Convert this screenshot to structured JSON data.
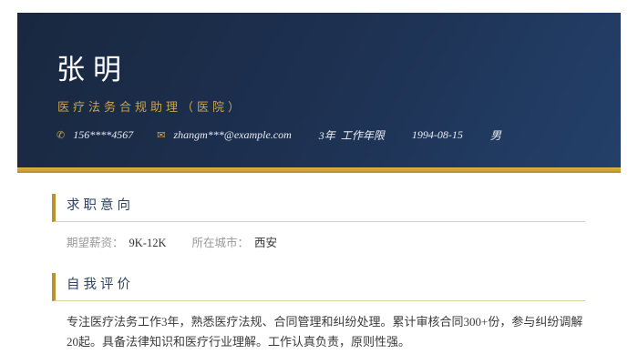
{
  "header": {
    "name": "张明",
    "job_title": "医疗法务合规助理（医院）",
    "contact": {
      "phone_glyph": "✆",
      "phone": "156****4567",
      "email_glyph": "✉",
      "email": "zhangm***@example.com",
      "experience_value": "3年",
      "experience_label": "工作年限",
      "birth_date": "1994-08-15",
      "gender": "男"
    }
  },
  "sections": [
    {
      "title": "求职意向",
      "fields": [
        {
          "label": "期望薪资：",
          "value": "9K-12K"
        },
        {
          "label": "所在城市：",
          "value": "西安"
        }
      ]
    },
    {
      "title": "自我评价",
      "paragraph": "专注医疗法务工作3年，熟悉医疗法规、合同管理和纠纷处理。累计审核合同300+份，参与纠纷调解20起。具备法律知识和医疗行业理解。工作认真负责，原则性强。"
    }
  ],
  "colors": {
    "header_navy_dark": "#192840",
    "header_navy_light": "#23406a",
    "gold_accent": "#c9a450",
    "gold_strip_top": "#dcb64a",
    "gold_strip_bottom": "#b78f2b",
    "section_bar_gold": "#b8932f",
    "section_underline": "#ddd0a8",
    "section_title_navy": "#2e4260",
    "label_gray": "#999999",
    "value_dark": "#333333",
    "paragraph_text": "#3a3a3a"
  }
}
